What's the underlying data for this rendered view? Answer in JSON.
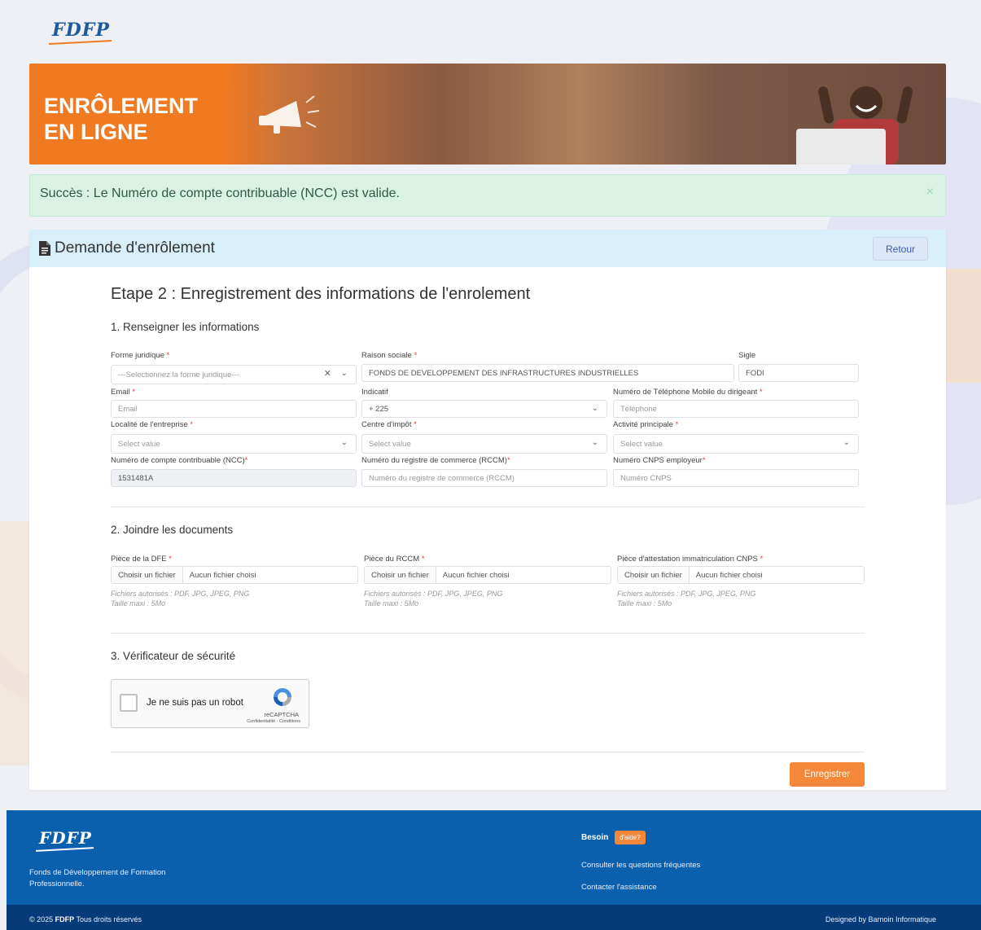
{
  "header": {
    "logo_text": "FDFP"
  },
  "banner": {
    "line1": "ENRÔLEMENT",
    "line2": "EN LIGNE"
  },
  "alert": {
    "message": "Succès : Le Numéro de compte contribuable (NCC) est valide.",
    "close": "×"
  },
  "card": {
    "title": "Demande d'enrôlement",
    "back_label": "Retour",
    "step_title": "Etape 2 : Enregistrement des informations de l'enrolement"
  },
  "section1": {
    "title": "1. Renseigner les informations",
    "forme_label": "Forme juridique",
    "forme_placeholder": "---Selectionnez la forme juridique---",
    "raison_label": "Raison sociale",
    "raison_value": "FONDS DE DEVELOPPEMENT DES INFRASTRUCTURES INDUSTRIELLES",
    "sigle_label": "Sigle",
    "sigle_value": "FODI",
    "email_label": "Email",
    "email_placeholder": "Email",
    "indicatif_label": "Indicatif",
    "indicatif_value": "+ 225",
    "tel_label": "Numéro de Téléphone Mobile du dirigeant",
    "tel_placeholder": "Téléphone",
    "localite_label": "Localité de l'entreprise",
    "localite_placeholder": "Select value",
    "centre_label": "Centre d'impôt",
    "centre_placeholder": "Select value",
    "activite_label": "Activité principale",
    "activite_placeholder": "Select value",
    "ncc_label": "Numéro de compte contribuable (NCC)",
    "ncc_value": "1531481A",
    "rccm_label": "Numéro du registre de commerce (RCCM)",
    "rccm_placeholder": "Numéro du registre de  commerce (RCCM)",
    "cnps_label": "Numéro CNPS employeur",
    "cnps_placeholder": "Numéro CNPS",
    "required_mark": "*"
  },
  "section2": {
    "title": "2. Joindre les documents",
    "choose_label": "Choisir un fichier",
    "none_label": "Aucun fichier choisi",
    "hint_types": "Fichiers autorisés : PDF, JPG, JPEG, PNG",
    "hint_size": "Taille maxi : 5Mo",
    "files": [
      {
        "label": "Pièce de la DFE"
      },
      {
        "label": "Pièce du RCCM"
      },
      {
        "label": "Pièce d'attestation immatriculation CNPS"
      }
    ]
  },
  "section3": {
    "title": "3. Vérificateur de sécurité",
    "captcha_text": "Je ne suis pas un robot",
    "captcha_brand": "reCAPTCHA",
    "captcha_links": "Confidentialité - Conditions"
  },
  "save_label": "Enregistrer",
  "footer": {
    "logo_text": "FDFP",
    "description": "Fonds de Développement de Formation Professionnelle.",
    "besoin": "Besoin",
    "aide": "d'aide?",
    "link_faq": "Consulter les questions fréquentes",
    "link_assist": "Contacter l'assistance",
    "copyright_prefix": "© 2025",
    "copyright_brand": "FDFP",
    "copyright_suffix": "Tous droits réservés",
    "designed_by": "Designed by Barnoin Informatique"
  },
  "colors": {
    "accent_orange": "#f5873a",
    "footer_blue": "#0b60ae",
    "success_bg": "#d9f2e4",
    "card_head_bg": "#d8eef9"
  }
}
